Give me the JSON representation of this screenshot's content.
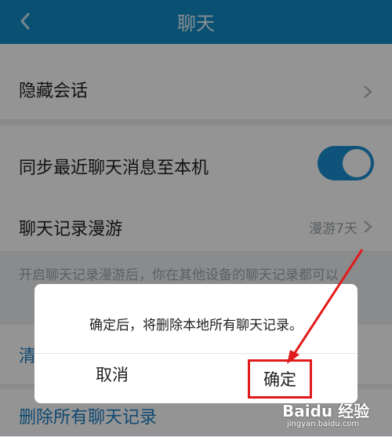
{
  "header": {
    "title": "聊天"
  },
  "rows": {
    "hidden_chats": "隐藏会话",
    "sync_recent": "同步最近聊天消息至本机",
    "history_roaming": "聊天记录漫游",
    "history_roaming_value": "漫游7天",
    "partial_clear": "清",
    "delete_all": "删除所有聊天记录"
  },
  "hint": {
    "text": "开启聊天记录漫游后，你在其他设备的聊天记录都可以"
  },
  "dialog": {
    "message": "确定后，将删除本地所有聊天记录。",
    "cancel": "取消",
    "confirm": "确定"
  },
  "toggle": {
    "sync_recent": true
  },
  "watermark": {
    "brand": "Baidu 经验",
    "domain": "jingyan.baidu.com"
  },
  "colors": {
    "header": "#118bc6",
    "toggle_on": "#1c8fd3",
    "highlight": "#e01b1b"
  },
  "icons": {
    "back": "back-arrow-icon",
    "chevron": "chevron-right-icon",
    "annotation": "red-arrow-icon"
  }
}
